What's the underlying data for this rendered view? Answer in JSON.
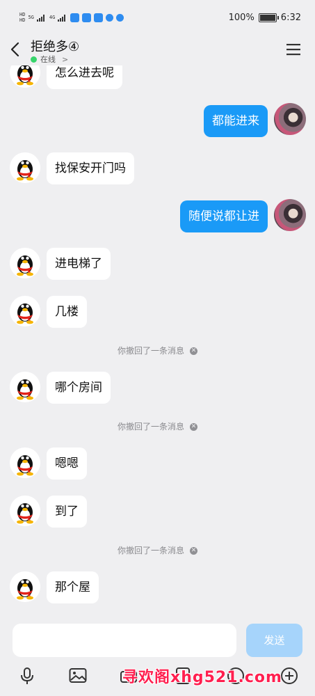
{
  "status_bar": {
    "network_label_1": "HD",
    "network_label_2": "HD",
    "signal_1": "5G",
    "signal_2": "4G",
    "battery_percent": "100%",
    "battery_level": 1.0,
    "time": "6:32"
  },
  "header": {
    "title": "拒绝多④",
    "presence": "在线",
    "presence_arrow": ">"
  },
  "messages": [
    {
      "side": "in",
      "text": "怎么进去呢"
    },
    {
      "side": "out",
      "text": "都能进来"
    },
    {
      "side": "in",
      "text": "找保安开门吗"
    },
    {
      "side": "out",
      "text": "随便说都让进"
    },
    {
      "side": "in",
      "text": "进电梯了"
    },
    {
      "side": "in",
      "text": "几楼"
    },
    {
      "side": "recall",
      "text": "你撤回了一条消息"
    },
    {
      "side": "in",
      "text": "哪个房间"
    },
    {
      "side": "recall",
      "text": "你撤回了一条消息"
    },
    {
      "side": "in",
      "text": "嗯嗯"
    },
    {
      "side": "in",
      "text": "到了"
    },
    {
      "side": "recall",
      "text": "你撤回了一条消息"
    },
    {
      "side": "in",
      "text": "那个屋"
    }
  ],
  "composer": {
    "input_value": "",
    "send_label": "发送"
  },
  "watermark": "寻欢阁xhg521.com",
  "colors": {
    "accent": "#1a9af7",
    "online": "#37d46b",
    "background": "#efeff1"
  },
  "icons": {
    "back": "chevron-left-icon",
    "menu": "hamburger-icon",
    "voice": "microphone-icon",
    "image": "image-icon",
    "plus": "plus-circle-icon"
  }
}
